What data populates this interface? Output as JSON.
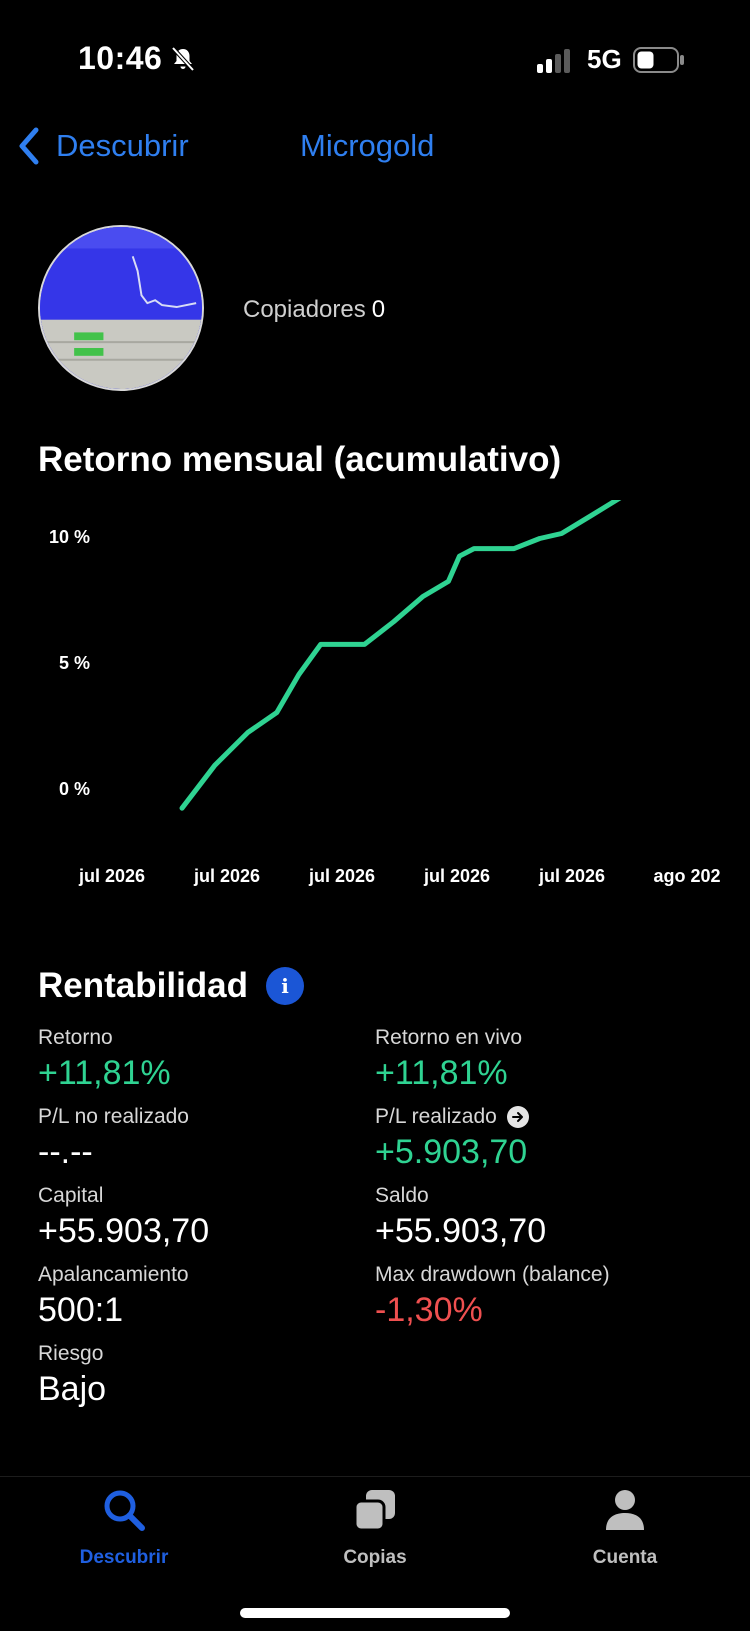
{
  "status_bar": {
    "time": "10:46",
    "network": "5G"
  },
  "nav": {
    "back_label": "Descubrir",
    "title": "Microgold"
  },
  "profile": {
    "copiers_label": "Copiadores",
    "copiers_count": "0"
  },
  "chart_title": "Retorno mensual (acumulativo)",
  "chart_data": {
    "type": "line",
    "title": "Retorno mensual (acumulativo)",
    "xlabel": "",
    "ylabel": "",
    "x_ticks": [
      "jul 2026",
      "jul 2026",
      "jul 2026",
      "jul 2026",
      "jul 2026",
      "ago 202"
    ],
    "y_ticks": [
      "0 %",
      "5 %",
      "10 %"
    ],
    "ylim": [
      -0.8,
      11.9
    ],
    "grid": false,
    "series": [
      {
        "color": "#2fd392",
        "points": [
          [
            0.0,
            -0.8
          ],
          [
            0.45,
            0.9
          ],
          [
            0.9,
            2.2
          ],
          [
            1.3,
            3.0
          ],
          [
            1.6,
            4.5
          ],
          [
            1.9,
            5.7
          ],
          [
            2.5,
            5.7
          ],
          [
            2.9,
            6.6
          ],
          [
            3.3,
            7.6
          ],
          [
            3.65,
            8.2
          ],
          [
            3.8,
            9.2
          ],
          [
            4.0,
            9.5
          ],
          [
            4.55,
            9.5
          ],
          [
            4.9,
            9.9
          ],
          [
            5.2,
            10.1
          ],
          [
            5.6,
            10.8
          ],
          [
            6.05,
            11.6
          ],
          [
            6.3,
            11.9
          ]
        ]
      }
    ]
  },
  "rentabilidad": {
    "title": "Rentabilidad",
    "retorno": {
      "label": "Retorno",
      "value": "+11,81%"
    },
    "retorno_vivo": {
      "label": "Retorno en vivo",
      "value": "+11,81%"
    },
    "pl_no_realizado": {
      "label": "P/L no realizado",
      "value": "--.--"
    },
    "pl_realizado": {
      "label": "P/L realizado",
      "value": "+5.903,70"
    },
    "capital": {
      "label": "Capital",
      "value": "+55.903,70"
    },
    "saldo": {
      "label": "Saldo",
      "value": "+55.903,70"
    },
    "apalancamiento": {
      "label": "Apalancamiento",
      "value": "500:1"
    },
    "max_drawdown": {
      "label": "Max drawdown (balance)",
      "value": "-1,30%"
    },
    "riesgo": {
      "label": "Riesgo",
      "value": "Bajo"
    }
  },
  "tabs": [
    {
      "label": "Descubrir",
      "icon": "search-icon",
      "active": true
    },
    {
      "label": "Copias",
      "icon": "copies-icon",
      "active": false
    },
    {
      "label": "Cuenta",
      "icon": "person-icon",
      "active": false
    }
  ],
  "colors": {
    "accent": "#2f7ff0",
    "positive": "#2fd392",
    "negative": "#ef5050"
  }
}
